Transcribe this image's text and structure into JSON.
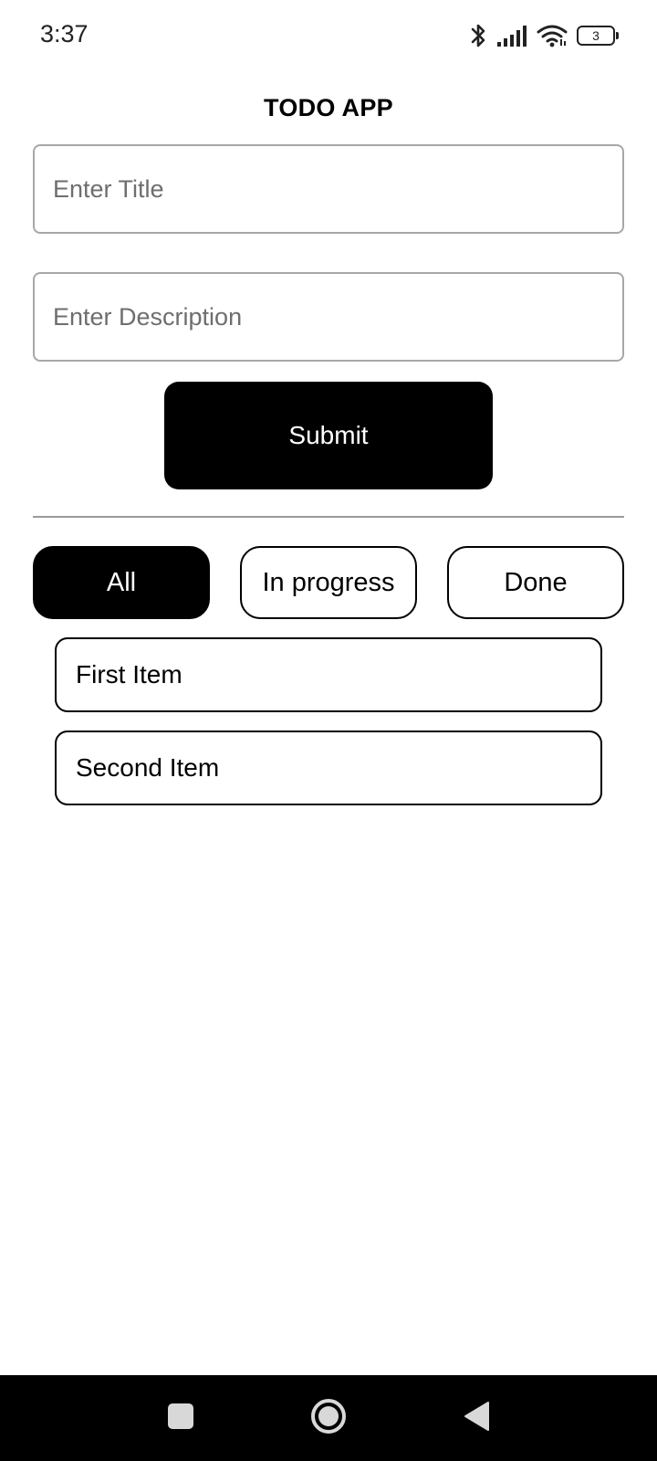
{
  "status_bar": {
    "time": "3:37",
    "battery_level": "3",
    "icons": [
      "bluetooth-icon",
      "signal-icon",
      "wifi-icon",
      "battery-icon"
    ]
  },
  "app": {
    "title": "TODO APP"
  },
  "form": {
    "title_placeholder": "Enter Title",
    "title_value": "",
    "description_placeholder": "Enter Description",
    "description_value": "",
    "submit_label": "Submit"
  },
  "filters": {
    "selected": "All",
    "tabs": [
      {
        "label": "All"
      },
      {
        "label": "In progress"
      },
      {
        "label": "Done"
      }
    ]
  },
  "todos": [
    {
      "title": "First Item"
    },
    {
      "title": "Second Item"
    }
  ],
  "nav": {
    "buttons": [
      "recents-icon",
      "home-icon",
      "back-icon"
    ]
  },
  "colors": {
    "primary": "#000000",
    "background": "#ffffff",
    "input_border": "#a7a7a7",
    "placeholder": "#6e6e6e"
  }
}
